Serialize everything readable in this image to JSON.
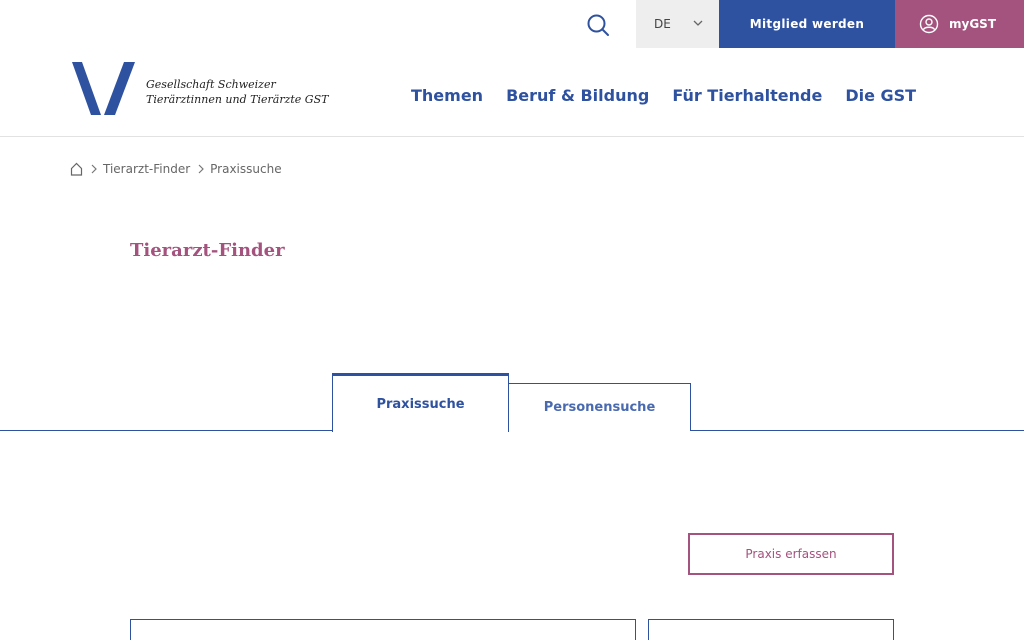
{
  "topbar": {
    "language": "DE",
    "member_label": "Mitglied werden",
    "mygst_label": "myGST"
  },
  "logo": {
    "line1": "Gesellschaft Schweizer",
    "line2": "Tierärztinnen und Tierärzte GST"
  },
  "nav": {
    "items": [
      {
        "label": "Themen"
      },
      {
        "label": "Beruf & Bildung"
      },
      {
        "label": "Für Tierhaltende"
      },
      {
        "label": "Die GST"
      }
    ]
  },
  "breadcrumb": {
    "items": [
      {
        "label": "Tierarzt-Finder"
      },
      {
        "label": "Praxissuche"
      }
    ]
  },
  "page": {
    "title": "Tierarzt-Finder"
  },
  "tabs": [
    {
      "label": "Praxissuche",
      "active": true
    },
    {
      "label": "Personensuche",
      "active": false
    }
  ],
  "actions": {
    "praxis_erfassen": "Praxis erfassen"
  },
  "colors": {
    "brand_blue": "#2f52a0",
    "brand_magenta": "#a4527e"
  }
}
